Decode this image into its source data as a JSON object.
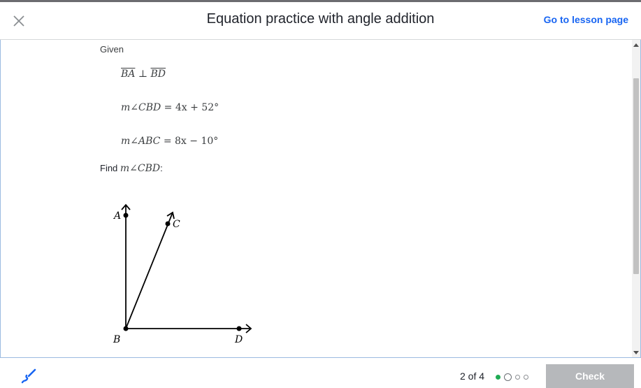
{
  "header": {
    "title": "Equation practice with angle addition",
    "lesson_link": "Go to lesson page",
    "close_icon": "close-icon"
  },
  "problem": {
    "given_label": "Given",
    "statement1": {
      "seg1": "BA",
      "op": " ⊥ ",
      "seg2": "BD"
    },
    "statement2": {
      "lhs": "m∠CBD",
      "rhs": " = 4x + 52°"
    },
    "statement3": {
      "lhs": "m∠ABC",
      "rhs": " = 8x − 10°"
    },
    "find_label": "Find ",
    "find_expr": "m∠CBD",
    "find_colon": ":"
  },
  "figure": {
    "points": [
      "A",
      "C",
      "B",
      "D"
    ],
    "label_A": "A",
    "label_B": "B",
    "label_C": "C",
    "label_D": "D"
  },
  "footer": {
    "progress_text": "2 of 4",
    "progress": {
      "current": 2,
      "total": 4,
      "completed": 1
    },
    "check_label": "Check",
    "pencil_icon": "scratchpad-pencil-icon"
  },
  "colors": {
    "link": "#1865f2",
    "done_dot": "#1fab54",
    "check_disabled": "#b6b8bb",
    "content_border": "#9bbbe0"
  }
}
